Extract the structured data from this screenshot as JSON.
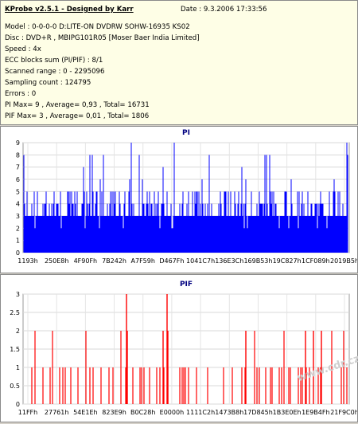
{
  "info": {
    "title": "KProbe v2.5.1 - Designed by Karr",
    "date": "Date : 9.3.2006 17:33:56",
    "lines": [
      "Model : 0-0-0-0 D:LITE-ON DVDRW SOHW-16935 KS02",
      "Disc : DVD+R , MBIPG101R05 [Moser Baer India Limited]",
      "Speed : 4x",
      "ECC blocks sum (PI/PIF) : 8/1",
      "Scanned range : 0 - 2295096",
      "Sampling count : 124795",
      "Errors : 0",
      "PI Max= 9 , Average= 0,93 , Total= 16731",
      "PIF Max= 3 , Average= 0,01 , Total= 1806"
    ]
  },
  "watermark": "www.cdr.cz",
  "chart_data": [
    {
      "type": "bar",
      "title": "PI",
      "color": "#0000ff",
      "ylim": [
        0,
        9
      ],
      "yticks": [
        "0",
        "1",
        "2",
        "3",
        "4",
        "5",
        "6",
        "7",
        "8",
        "9"
      ],
      "xticks": [
        "1193h",
        "250E8h",
        "4F90Fh",
        "7B242h",
        "A7F59h",
        "D467Fh",
        "1041C7h",
        "136E3Ch",
        "169B53h",
        "19C827h",
        "1CF089h",
        "2019B5h"
      ],
      "profile": {
        "baseline": 3,
        "typical_peaks": [
          4,
          5
        ],
        "occasional_peaks": [
          6,
          7,
          8
        ],
        "max": 9,
        "average": 0.93
      }
    },
    {
      "type": "bar",
      "title": "PIF",
      "color": "#ff0000",
      "ylim": [
        0,
        3
      ],
      "yticks": [
        "0",
        "0.5",
        "1",
        "1.5",
        "2",
        "2.5",
        "3"
      ],
      "xticks": [
        "11FFh",
        "27761h",
        "54E1Eh",
        "823E9h",
        "B0C28h",
        "E0000h",
        "1111C2h",
        "1473B8h",
        "17D845h",
        "1B3E0Eh",
        "1E9B4Fh",
        "21F9C0h"
      ],
      "profile": {
        "typical": 1,
        "occasional_peaks": [
          2
        ],
        "max": 3,
        "average": 0.01
      }
    }
  ]
}
